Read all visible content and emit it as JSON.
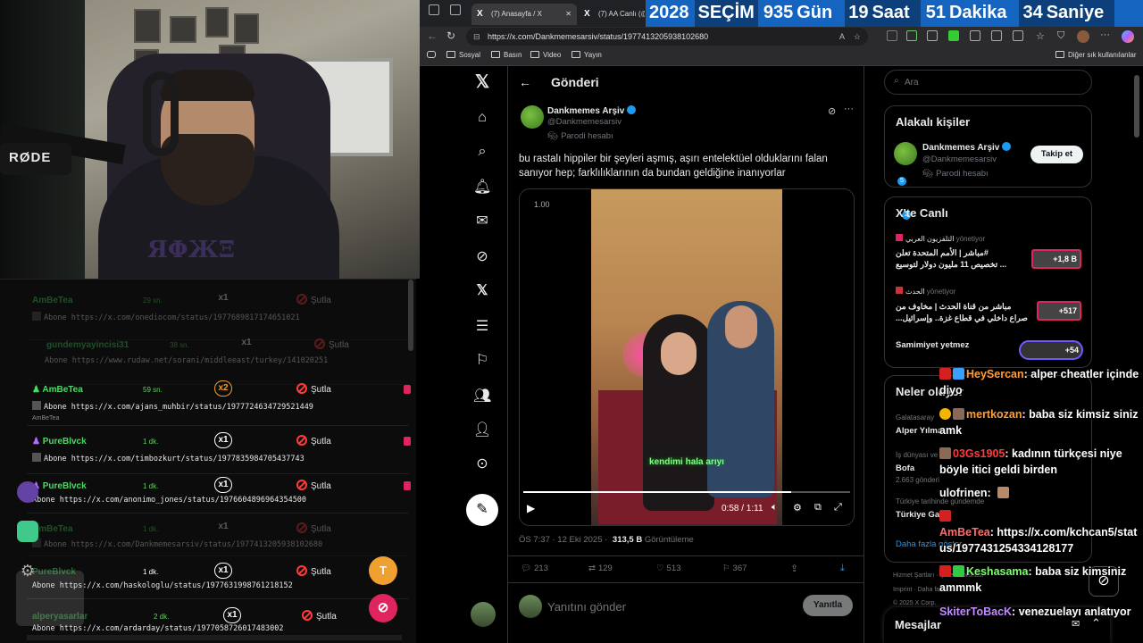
{
  "webcam": {
    "mic_brand": "RØDE"
  },
  "log_panel": {
    "rows": [
      {
        "user": "AmBeTea",
        "time": "29 sn.",
        "mult": "x1",
        "action": "Şutla",
        "url": "Abone https://x.com/onediocom/status/1977689817174651021",
        "sub": ""
      },
      {
        "user": "gundemyayincisi31",
        "time": "38 sn.",
        "mult": "x1",
        "action": "Şutla",
        "url": "Abone https://www.rudaw.net/sorani/middleeast/turkey/141020251",
        "sub": ""
      },
      {
        "user": "AmBeTea",
        "time": "59 sn.",
        "mult": "x2",
        "action": "Şutla",
        "url": "Abone https://x.com/ajans_muhbir/status/1977724634729521449",
        "sub": "AmBeTea"
      },
      {
        "user": "PureBlvck",
        "time": "1 dk.",
        "mult": "x1",
        "action": "Şutla",
        "url": "Abone https://x.com/timbozkurt/status/1977835984705437743",
        "sub": ""
      },
      {
        "user": "PureBlvck",
        "time": "1 dk.",
        "mult": "x1",
        "action": "Şutla",
        "url": "Abone https://x.com/anonimo_jones/status/1976604896964354500",
        "sub": ""
      },
      {
        "user": "AmBeTea",
        "time": "1 dk.",
        "mult": "x1",
        "action": "Şutla",
        "url": "Abone https://x.com/Dankmemesarsiv/status/1977413205938102680",
        "sub": ""
      },
      {
        "user": "PureBlvck",
        "time": "1 dk.",
        "mult": "x1",
        "action": "Şutla",
        "url": "Abone https://x.com/haskologlu/status/1977631998761218152",
        "sub": ""
      },
      {
        "user": "alperyasarlar",
        "time": "2 dk.",
        "mult": "x1",
        "action": "Şutla",
        "url": "Abone https://x.com/ardarday/status/1977058726017483002",
        "sub": ""
      }
    ],
    "btn_t": "T"
  },
  "browser": {
    "tabs": [
      {
        "label": "(7) Anasayfa / X"
      },
      {
        "label": "(7) AA Canlı (@"
      }
    ],
    "countdown": {
      "year": "2028",
      "label": "SEÇİM",
      "days": "935",
      "days_unit": "Gün",
      "hours": "19",
      "hours_unit": "Saat",
      "mins": "51",
      "mins_unit": "Dakika",
      "secs": "34",
      "secs_unit": "Saniye"
    },
    "url": "https://x.com/Dankmemesarsiv/status/1977413205938102680",
    "bookmarks": [
      "Sosyal",
      "Basın",
      "Video",
      "Yayın"
    ],
    "bookmarks_right": "Diğer sık kullanılanlar"
  },
  "post": {
    "header": "Gönderi",
    "author_name": "Dankmemes Arşiv",
    "author_handle": "@Dankmemesarsiv",
    "parody": "Parodi hesabı",
    "text": "bu rastalı hippiler bir şeyleri aşmış, aşırı entelektüel olduklarını falan sanıyor hep; farklılıklarının da bundan geldiğine inanıyorlar",
    "video": {
      "speed": "1.00",
      "caption": "kendimi hala arıyı",
      "time": "0:58 / 1:11",
      "progress": 0.82
    },
    "meta_time": "ÖS 7:37 · 12 Eki 2025 ·",
    "views": "313,5 B",
    "views_label": "Görüntüleme",
    "stats": {
      "replies": "213",
      "reposts": "129",
      "likes": "513",
      "bookmarks": "367"
    },
    "reply_placeholder": "Yanıtını gönder",
    "reply_button": "Yanıtla"
  },
  "right": {
    "search_placeholder": "Ara",
    "related_title": "Alakalı kişiler",
    "related": {
      "name": "Dankmemes Arşiv",
      "handle": "@Dankmemesarsiv",
      "parody": "Parodi hesabı",
      "follow": "Takip et"
    },
    "live_title": "X'te Canlı",
    "live": [
      {
        "host": "التلفزيون العربي",
        "status": "yönetiyor",
        "title1": "مباشر | الأمم المتحدة تعلن#",
        "title2": "تخصيص 11 مليون دولار لتوسيع ...",
        "count": "+1,8 B"
      },
      {
        "host": "الحدث",
        "status": "yönetiyor",
        "title1": "مباشر من قناة الحدث | مخاوف من",
        "title2": "...صراع داخلي في قطاع غزة.. وإسرائيل",
        "count": "+517"
      },
      {
        "host": "",
        "status": "",
        "title1": "Samimiyet yetmez",
        "title2": "",
        "count": "+54"
      }
    ],
    "trends_title": "Neler oluyor",
    "trends": [
      {
        "cat": "Galatasaray",
        "name": "Alper Yılma"
      },
      {
        "cat": "İş dünyası ve",
        "name": "Bofa",
        "posts": "2.663 gönderi"
      },
      {
        "cat": "Türkiye tarihinde gündemde",
        "name": "Türkiye Ga"
      }
    ],
    "more": "Daha fazla göster",
    "footer1": "Hizmet Şartları",
    "footer1b": "Çerez Politikası",
    "footer2": "Imprint",
    "footer2b": "Daha fazla ...",
    "footer3": "© 2025 X Corp.",
    "messages": "Mesajlar"
  },
  "chat": [
    {
      "nick": "HeySercan",
      "color": "#ff9d3b",
      "msg": "alper cheatler içinde diyo"
    },
    {
      "nick": "mertkozan",
      "color": "#ff9d3b",
      "msg": "baba siz kimsiz siniz amk"
    },
    {
      "nick": "03Gs1905",
      "color": "#ff3b3b",
      "msg": "kadının türkçesi niye böyle itici geldi birden"
    },
    {
      "nick": "ulofrinen",
      "color": "#ffffff",
      "msg": ""
    },
    {
      "nick": "AmBeTea",
      "color": "#ff6b6b",
      "msg": "https://x.com/kchcan5/status/1977431254334128177"
    },
    {
      "nick": "Keshasama",
      "color": "#7cff6b",
      "msg": "baba siz kimsiniz ammmk"
    },
    {
      "nick": "SkiterToBacK",
      "color": "#c38bff",
      "msg": "venezuelayı anlatıyor"
    }
  ]
}
